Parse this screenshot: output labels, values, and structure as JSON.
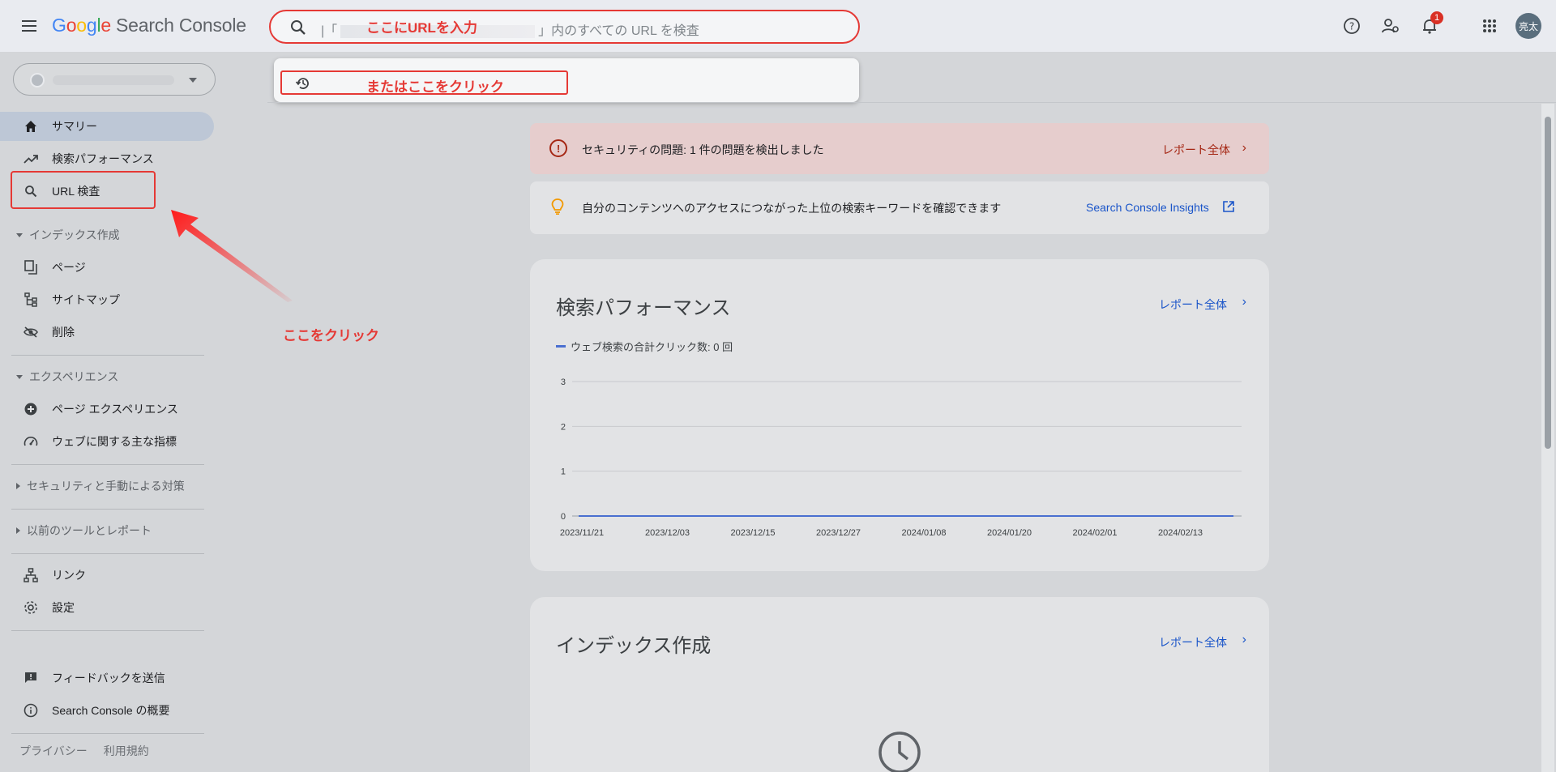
{
  "header": {
    "logo_google": [
      "G",
      "o",
      "o",
      "g",
      "l",
      "e"
    ],
    "product_name": "Search Console",
    "search_prefix": "|「",
    "search_suffix": "」内のすべての URL を検査",
    "search_annotation": "ここにURLを入力",
    "dropdown_annotation": "またはここをクリック",
    "notification_count": "1",
    "avatar_text": "亮太",
    "icons": [
      "menu-icon",
      "help-icon",
      "manage-users-icon",
      "notifications-icon",
      "apps-icon"
    ]
  },
  "sidebar": {
    "items": [
      {
        "label": "サマリー",
        "icon": "home-icon"
      },
      {
        "label": "検索パフォーマンス",
        "icon": "trending-icon"
      },
      {
        "label": "URL 検査",
        "icon": "search-icon"
      }
    ],
    "sections": [
      {
        "label": "インデックス作成",
        "items": [
          {
            "label": "ページ",
            "icon": "pages-icon"
          },
          {
            "label": "サイトマップ",
            "icon": "sitemap-icon"
          },
          {
            "label": "削除",
            "icon": "removals-icon"
          }
        ]
      },
      {
        "label": "エクスペリエンス",
        "items": [
          {
            "label": "ページ エクスペリエンス",
            "icon": "plus-circle-icon"
          },
          {
            "label": "ウェブに関する主な指標",
            "icon": "gauge-icon"
          }
        ]
      },
      {
        "label": "セキュリティと手動による対策"
      },
      {
        "label": "以前のツールとレポート"
      }
    ],
    "bottom_items": [
      {
        "label": "リンク",
        "icon": "links-icon"
      },
      {
        "label": "設定",
        "icon": "settings-icon"
      }
    ],
    "feedback": {
      "label": "フィードバックを送信",
      "icon": "feedback-icon"
    },
    "about": {
      "label": "Search Console の概要",
      "icon": "info-icon"
    },
    "footer": {
      "privacy": "プライバシー",
      "terms": "利用規約"
    },
    "click_annotation": "ここをクリック"
  },
  "main": {
    "alert": {
      "text": "セキュリティの問題: 1 件の問題を検出しました",
      "link": "レポート全体",
      "color": "#a52714"
    },
    "insights": {
      "text": "自分のコンテンツへのアクセスにつながった上位の検索キーワードを確認できます",
      "link": "Search Console Insights"
    },
    "performance_card": {
      "title": "検索パフォーマンス",
      "link": "レポート全体",
      "legend": "ウェブ検索の合計クリック数: 0 回"
    },
    "index_card": {
      "title": "インデックス作成",
      "link": "レポート全体"
    }
  },
  "chart_data": {
    "type": "line",
    "x": [
      "2023/11/21",
      "2023/12/03",
      "2023/12/15",
      "2023/12/27",
      "2024/01/08",
      "2024/01/20",
      "2024/02/01",
      "2024/02/13"
    ],
    "series": [
      {
        "values": [
          0,
          0,
          0,
          0,
          0,
          0,
          0,
          0
        ],
        "color": "#4a6fd0"
      }
    ],
    "ylim": [
      0,
      3
    ],
    "yticks": [
      0,
      1,
      2,
      3
    ],
    "grid": true
  }
}
